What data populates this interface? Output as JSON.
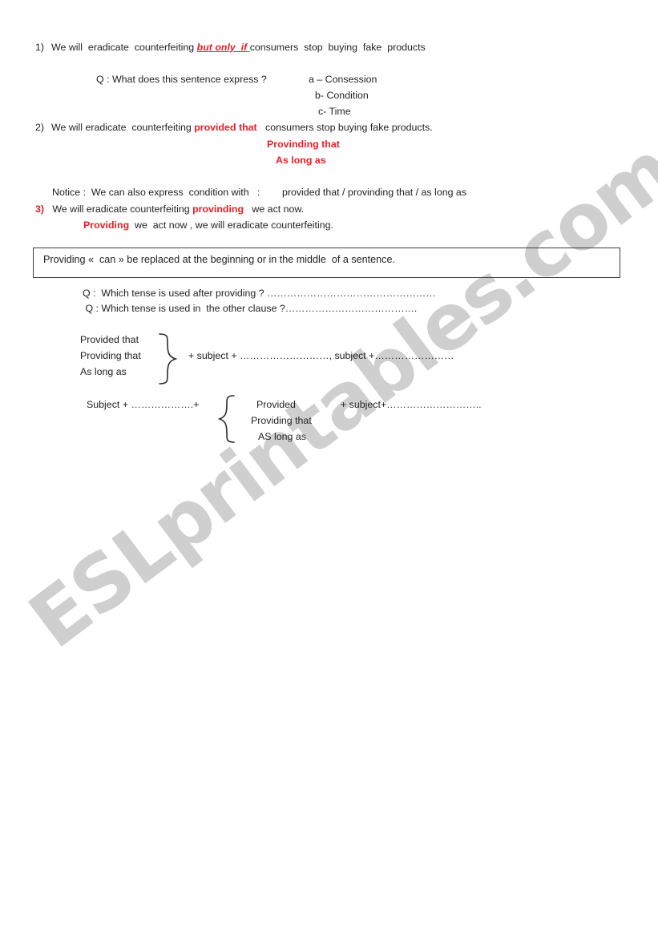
{
  "document": {
    "watermark": "ESLprintables.com",
    "accent_red": "#ee1c25",
    "text_color": "#1f1f1f",
    "box_border_color": "#3a3a42",
    "watermark_color": "#cfcfcf"
  },
  "item1": {
    "number": "1)",
    "part_a": "We will  eradicate  counterfeiting ",
    "highlight": "but only  if ",
    "part_b": "consumers  stop  buying  fake  products"
  },
  "question1": {
    "prompt": "Q : What does this sentence express ?",
    "options": [
      "a – Consession",
      "b- Condition",
      "c- Time"
    ]
  },
  "item2": {
    "number": "2)",
    "part_a": "We will eradicate  counterfeiting ",
    "highlight": "provided that",
    "part_b": "   consumers stop buying fake products.",
    "alt1": "Provinding that",
    "alt2": "As long as"
  },
  "notice_line": {
    "label": "Notice :",
    "text": "  We can also express  condition with   :        provided that / provinding that / as long as"
  },
  "item3": {
    "number": "3)",
    "part_a": "   We will eradicate counterfeiting ",
    "highlight": "provinding",
    "part_b": "   we act now.",
    "second_highlight": "Providing",
    "second_rest": "  we  act now , we will eradicate counterfeiting."
  },
  "notice_box": {
    "text": "Providing «  can » be replaced at the beginning or in the middle  of a sentence."
  },
  "tense_questions": [
    {
      "text": "Q :  Which tense is used after providing ? ",
      "dots": "……………………………………………"
    },
    {
      "text": " Q : Which tense is used in  the other clause ?",
      "dots": "…………………………………."
    }
  ],
  "structure1": {
    "items": [
      "Provided that",
      "Providing that",
      "As long as"
    ],
    "brace": "right-curly-brace",
    "formula": "+ subject + ………………………, subject +……………………"
  },
  "structure2": {
    "prefix": "Subject + ……………….+",
    "brace": "left-curly-brace",
    "items": [
      "Provided",
      "Providing that",
      "AS long as"
    ],
    "formula": "+ subject+……………………….."
  }
}
